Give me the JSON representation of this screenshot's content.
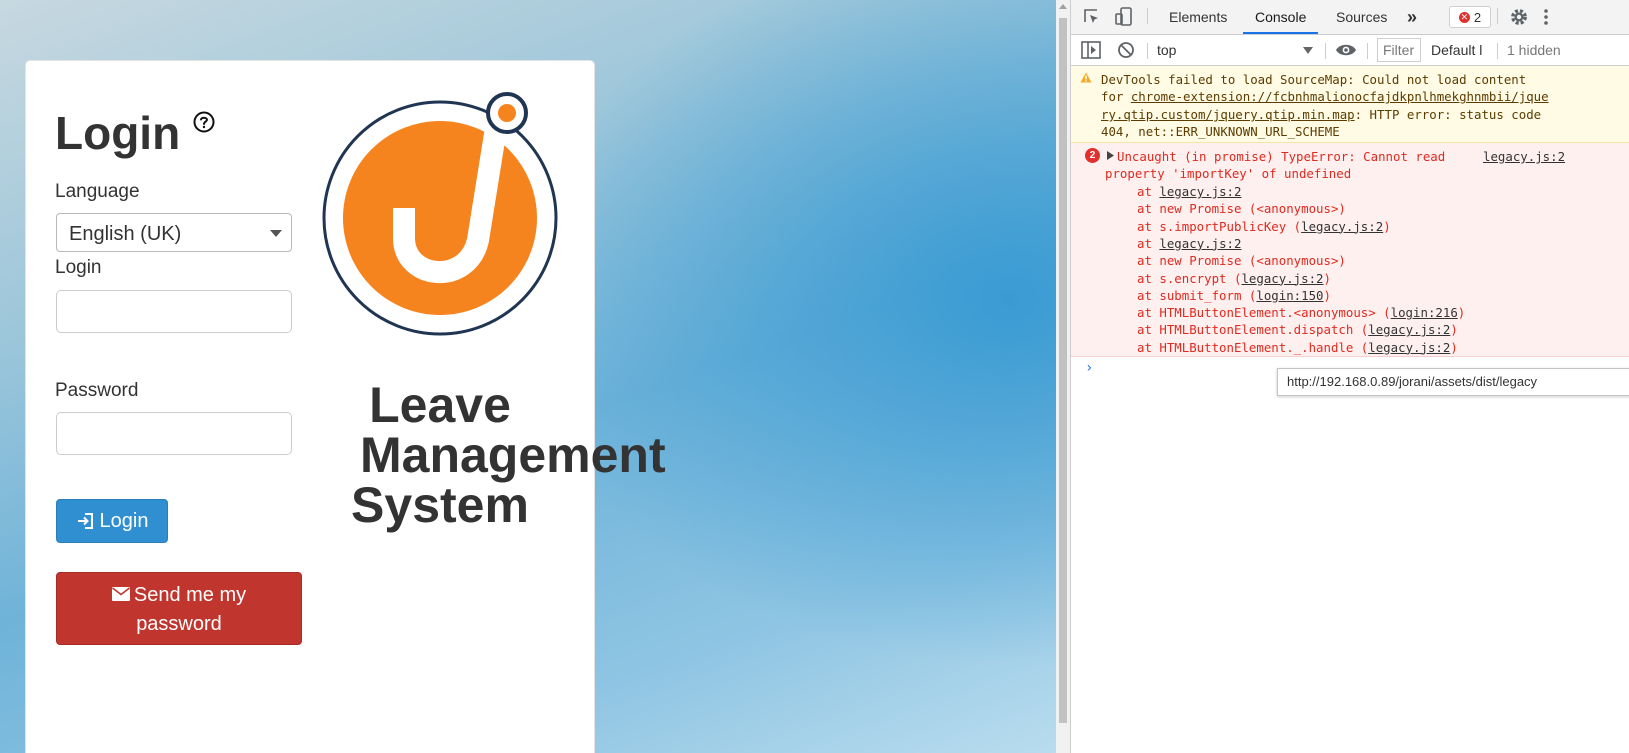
{
  "login_form": {
    "title": "Login",
    "language_label": "Language",
    "language_value": "English (UK)",
    "login_label": "Login",
    "login_value": "",
    "password_label": "Password",
    "password_value": "",
    "login_button": "Login",
    "send_password_line1": "Send me my",
    "send_password_line2": "password"
  },
  "brand": {
    "name_line1": "Leave",
    "name_line2": "Management",
    "name_line3": "System",
    "logo_color": "#f5841f",
    "logo_ring_color": "#1f3552"
  },
  "devtools": {
    "tabs": [
      "Elements",
      "Console",
      "Sources"
    ],
    "active_tab": "Console",
    "error_count": "2",
    "context": "top",
    "filter_placeholder": "Filter",
    "level": "Default l",
    "hidden": "1 hidden",
    "warning": {
      "l1": "DevTools failed to load SourceMap: Could not load content",
      "l2_pre": "for ",
      "l2_link": "chrome-extension://fcbnhmalionocfajdkpnlhmekghnmbii/jque",
      "l3_link": "ry.qtip.custom/jquery.qtip.min.map",
      "l3_post": ": HTTP error: status code",
      "l4": "404, net::ERR_UNKNOWN_URL_SCHEME"
    },
    "error": {
      "count": "2",
      "l1": "Uncaught (in promise) TypeError: Cannot read",
      "source": "legacy.js:2",
      "l2": "property 'importKey' of undefined",
      "stack": [
        {
          "pre": "at ",
          "link": "legacy.js:2",
          "post": ""
        },
        {
          "pre": "at new Promise (<anonymous>)",
          "link": "",
          "post": ""
        },
        {
          "pre": "at s.importPublicKey (",
          "link": "legacy.js:2",
          "post": ")"
        },
        {
          "pre": "at ",
          "link": "legacy.js:2",
          "post": ""
        },
        {
          "pre": "at new Promise (<anonymous>)",
          "link": "",
          "post": ""
        },
        {
          "pre": "at s.encrypt (",
          "link": "legacy.js:2",
          "post": ")"
        },
        {
          "pre": "at submit_form (",
          "link": "login:150",
          "post": ")"
        },
        {
          "pre": "at HTMLButtonElement.<anonymous> (",
          "link": "login:216",
          "post": ")"
        },
        {
          "pre": "at HTMLButtonElement.dispatch (",
          "link": "legacy.js:2",
          "post": ")"
        },
        {
          "pre": "at HTMLButtonElement._.handle (",
          "link": "legacy.js:2",
          "post": ")"
        }
      ]
    },
    "tooltip": "http://192.168.0.89/jorani/assets/dist/legacy"
  },
  "icons": {
    "help": "help-circle-icon",
    "login": "login-arrow-icon",
    "mail": "envelope-icon",
    "inspect": "inspect-icon",
    "device": "device-toolbar-icon",
    "more_tabs": "chevron-double-right-icon",
    "settings": "gear-icon",
    "menu": "kebab-menu-icon",
    "sidebar": "sidebar-toggle-icon",
    "clear": "clear-console-icon",
    "eye": "eye-icon",
    "warning": "warning-icon",
    "expand": "triangle-right-icon",
    "prompt": "chevron-right-icon"
  }
}
